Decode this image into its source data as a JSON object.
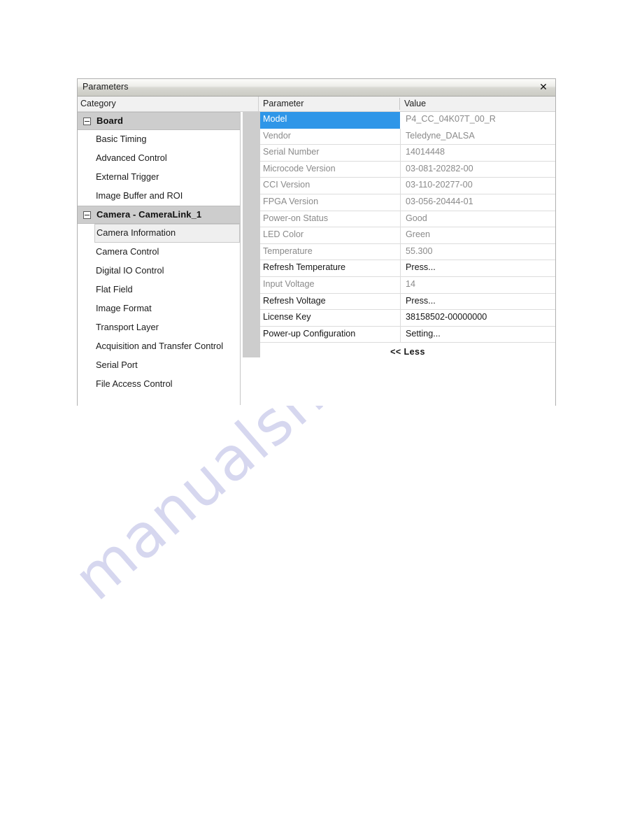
{
  "window": {
    "title": "Parameters",
    "close_icon": "close-icon",
    "close_glyph": "✕"
  },
  "columns": {
    "category": "Category",
    "parameter": "Parameter",
    "value": "Value"
  },
  "tree": {
    "groups": [
      {
        "label": "Board",
        "expander": "collapse-icon",
        "items": [
          {
            "label": "Basic Timing",
            "selected": false
          },
          {
            "label": "Advanced Control",
            "selected": false
          },
          {
            "label": "External Trigger",
            "selected": false
          },
          {
            "label": "Image Buffer and ROI",
            "selected": false
          }
        ]
      },
      {
        "label": "Camera - CameraLink_1",
        "expander": "collapse-icon",
        "items": [
          {
            "label": "Camera Information",
            "selected": true
          },
          {
            "label": "Camera Control",
            "selected": false
          },
          {
            "label": "Digital IO Control",
            "selected": false
          },
          {
            "label": "Flat Field",
            "selected": false
          },
          {
            "label": "Image Format",
            "selected": false
          },
          {
            "label": "Transport Layer",
            "selected": false
          },
          {
            "label": "Acquisition and Transfer Control",
            "selected": false
          },
          {
            "label": "Serial Port",
            "selected": false
          },
          {
            "label": "File Access Control",
            "selected": false
          }
        ]
      }
    ]
  },
  "table": {
    "rows": [
      {
        "name": "Model",
        "value": "P4_CC_04K07T_00_R",
        "state": "readonly",
        "selected": true
      },
      {
        "name": "Vendor",
        "value": "Teledyne_DALSA",
        "state": "readonly",
        "selected": false
      },
      {
        "name": "Serial Number",
        "value": "14014448",
        "state": "readonly",
        "selected": false
      },
      {
        "name": "Microcode Version",
        "value": "03-081-20282-00",
        "state": "readonly",
        "selected": false
      },
      {
        "name": "CCI Version",
        "value": "03-110-20277-00",
        "state": "readonly",
        "selected": false
      },
      {
        "name": "FPGA Version",
        "value": "03-056-20444-01",
        "state": "readonly",
        "selected": false
      },
      {
        "name": "Power-on Status",
        "value": "Good",
        "state": "readonly",
        "selected": false
      },
      {
        "name": "LED Color",
        "value": "Green",
        "state": "readonly",
        "selected": false
      },
      {
        "name": "Temperature",
        "value": "55.300",
        "state": "readonly",
        "selected": false
      },
      {
        "name": "Refresh Temperature",
        "value": "Press...",
        "state": "editable",
        "selected": false
      },
      {
        "name": "Input Voltage",
        "value": "14",
        "state": "readonly",
        "selected": false
      },
      {
        "name": "Refresh Voltage",
        "value": "Press...",
        "state": "editable",
        "selected": false
      },
      {
        "name": "License Key",
        "value": "38158502-00000000",
        "state": "editable",
        "selected": false
      },
      {
        "name": "Power-up Configuration",
        "value": "Setting...",
        "state": "editable",
        "selected": false
      }
    ],
    "less_toggle": "<< Less"
  },
  "watermark": {
    "text": "manualshive.com",
    "color": "#d6d7ef"
  },
  "colors": {
    "selection_blue": "#2f96e8",
    "group_header_gray": "#cdcdcd",
    "readonly_text": "#8a8a8a",
    "editable_text": "#161616"
  }
}
